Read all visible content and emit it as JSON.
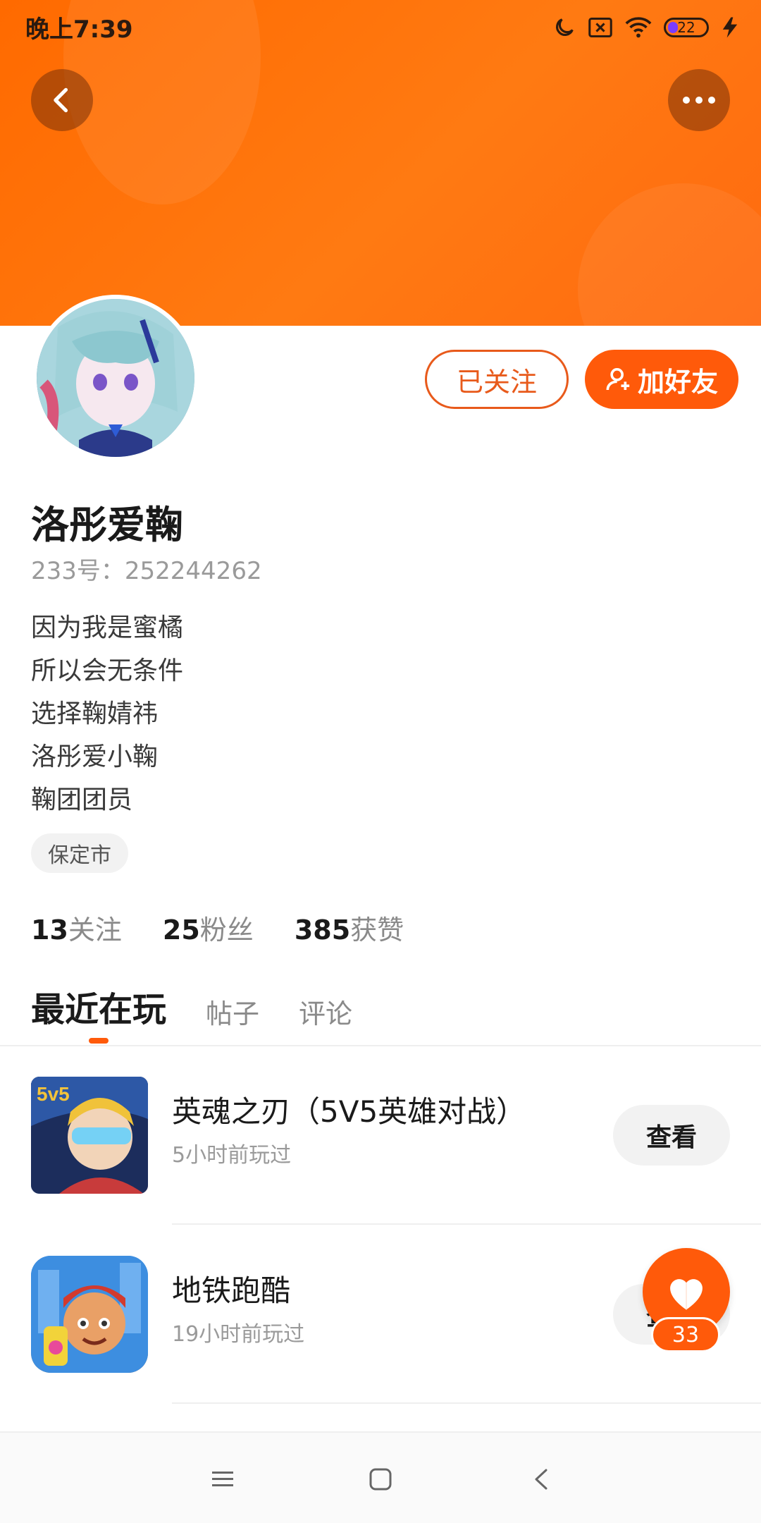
{
  "status_bar": {
    "time": "晚上7:39",
    "battery_level": "22",
    "icons": [
      "moon-icon",
      "sim-off-icon",
      "wifi-icon",
      "battery-icon",
      "charging-icon"
    ]
  },
  "header": {
    "back_icon": "chevron-left-icon",
    "more_icon": "more-horizontal-icon",
    "accent_color": "#ff6a00"
  },
  "profile": {
    "name": "洛彤爱鞠",
    "uid": "233号：252244262",
    "bio": [
      "因为我是蜜橘",
      "所以会无条件",
      "选择鞠婧祎",
      "洛彤爱小鞠",
      "鞠团团员"
    ],
    "location": "保定市",
    "stats": [
      {
        "value": "13",
        "label": "关注"
      },
      {
        "value": "25",
        "label": "粉丝"
      },
      {
        "value": "385",
        "label": "获赞"
      }
    ]
  },
  "actions": {
    "followed_label": "已关注",
    "add_friend_label": "加好友",
    "add_friend_icon": "user-plus-icon"
  },
  "tabs": [
    {
      "label": "最近在玩",
      "active": true
    },
    {
      "label": "帖子",
      "active": false
    },
    {
      "label": "评论",
      "active": false
    }
  ],
  "games": [
    {
      "title": "英魂之刃（5V5英雄对战）",
      "subtitle": "5小时前玩过",
      "button": "查看"
    },
    {
      "title": "地铁跑酷",
      "subtitle": "19小时前玩过",
      "button": "查看"
    }
  ],
  "like": {
    "count": "33",
    "icon": "heart-icon"
  },
  "nav_bar": {
    "icons": [
      "menu-icon",
      "home-square-icon",
      "back-chevron-icon"
    ]
  }
}
